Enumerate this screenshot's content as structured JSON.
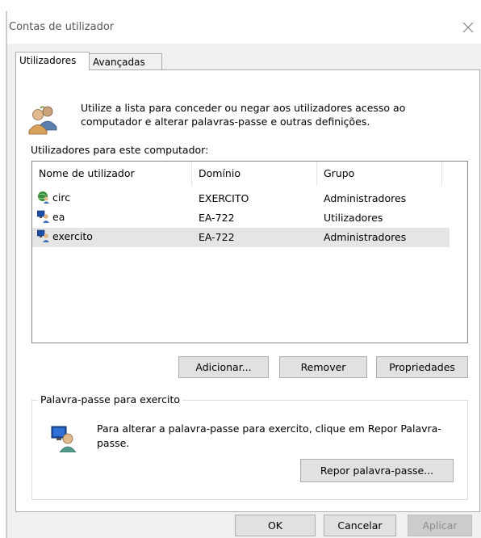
{
  "window": {
    "title": "Contas de utilizador",
    "close_glyph": "✕"
  },
  "tabs": [
    {
      "label": "Utilizadores",
      "active": true
    },
    {
      "label": "Avançadas",
      "active": false
    }
  ],
  "intro": {
    "icon": "users-group-icon",
    "text": "Utilize a lista para conceder ou negar aos utilizadores acesso ao computador e alterar palavras-passe e outras definições."
  },
  "users_list": {
    "label": "Utilizadores para este computador:",
    "columns": [
      "Nome de utilizador",
      "Domínio",
      "Grupo"
    ],
    "rows": [
      {
        "name": "circ",
        "domain": "EXERCITO",
        "group": "Administradores",
        "icon": "domain-user-icon",
        "selected": false
      },
      {
        "name": "ea",
        "domain": "EA-722",
        "group": "Utilizadores",
        "icon": "local-user-icon",
        "selected": false
      },
      {
        "name": "exercito",
        "domain": "EA-722",
        "group": "Administradores",
        "icon": "local-user-icon",
        "selected": true
      }
    ]
  },
  "list_buttons": {
    "add": "Adicionar...",
    "remove": "Remover",
    "properties": "Propriedades"
  },
  "password_group": {
    "legend": "Palavra-passe para exercito",
    "icon": "user-password-icon",
    "text": "Para alterar a palavra-passe para exercito, clique em Repor Palavra-passe.",
    "reset_button": "Repor palavra-passe..."
  },
  "dialog_buttons": {
    "ok": "OK",
    "cancel": "Cancelar",
    "apply": "Aplicar"
  }
}
